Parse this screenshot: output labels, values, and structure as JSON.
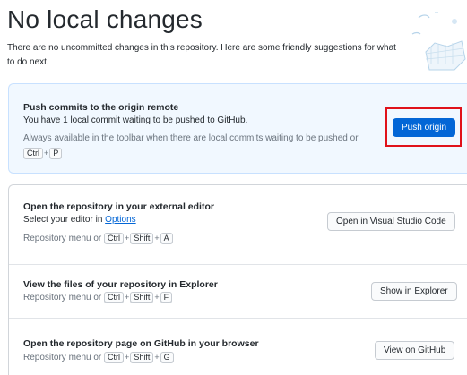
{
  "header": {
    "title": "No local changes",
    "description": "There are no uncommitted changes in this repository. Here are some friendly suggestions for what to do next."
  },
  "push_card": {
    "title": "Push commits to the origin remote",
    "status": "You have 1 local commit waiting to be pushed to GitHub.",
    "hint": "Always available in the toolbar when there are local commits waiting to be pushed or",
    "shortcut_keys": [
      "Ctrl",
      "P"
    ],
    "button_label": "Push origin"
  },
  "editor_card": {
    "title": "Open the repository in your external editor",
    "select_prefix": "Select your editor in",
    "options_link": "Options",
    "menu_prefix": "Repository menu or",
    "shortcut_keys": [
      "Ctrl",
      "Shift",
      "A"
    ],
    "button_label": "Open in Visual Studio Code"
  },
  "explorer_card": {
    "title": "View the files of your repository in Explorer",
    "menu_prefix": "Repository menu or",
    "shortcut_keys": [
      "Ctrl",
      "Shift",
      "F"
    ],
    "button_label": "Show in Explorer"
  },
  "github_card": {
    "title": "Open the repository page on GitHub in your browser",
    "menu_prefix": "Repository menu or",
    "shortcut_keys": [
      "Ctrl",
      "Shift",
      "G"
    ],
    "button_label": "View on GitHub"
  },
  "colors": {
    "primary_button": "#0366d6",
    "push_card_bg": "#f1f8ff",
    "highlight": "#e0121a"
  }
}
